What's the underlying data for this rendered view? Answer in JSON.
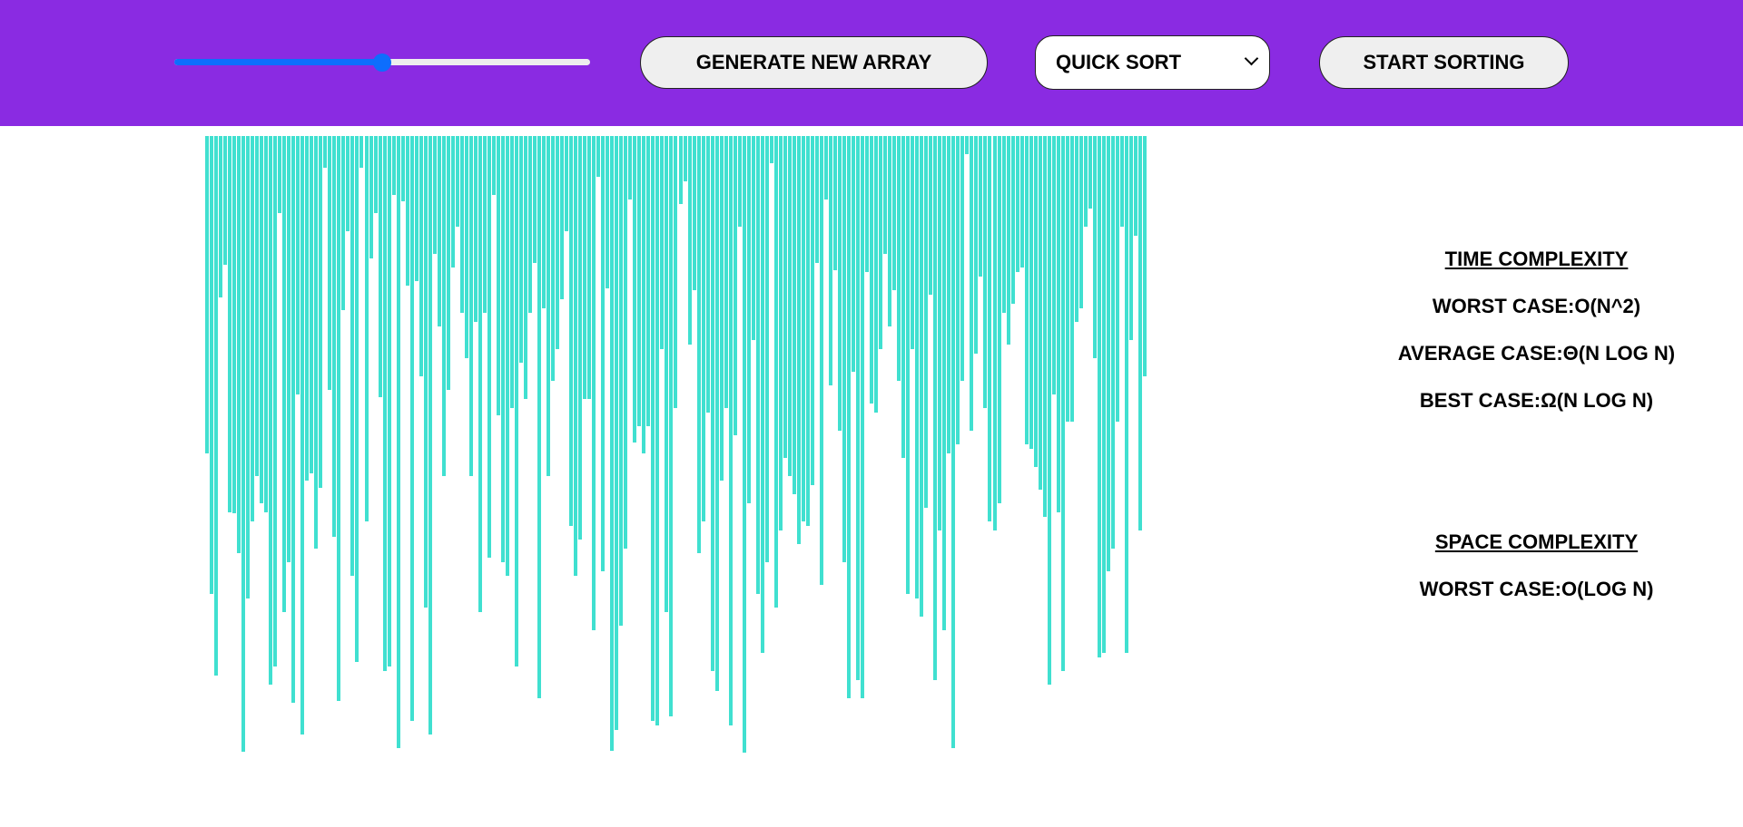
{
  "controls": {
    "array_size_slider": {
      "value": 0.5
    },
    "generate_button_label": "GENERATE NEW ARRAY",
    "algorithm_select": {
      "selected": "QUICK SORT",
      "icon": "chevron-down-icon"
    },
    "start_button_label": "START SORTING"
  },
  "colors": {
    "topbar": "#8a2be2",
    "bar": "#40e0d0",
    "slider_accent": "#0d6efd"
  },
  "complexity": {
    "time_heading": "TIME COMPLEXITY",
    "worst_case": "WORST CASE:O(N^2)",
    "average_case": "AVERAGE CASE:Θ(N LOG N)",
    "best_case": "BEST CASE:Ω(N LOG N)",
    "space_heading": "SPACE COMPLEXITY",
    "space_worst_case": "WORST CASE:O(LOG N)"
  },
  "chart_data": {
    "type": "bar",
    "values": [
      350,
      505,
      595,
      178,
      142,
      415,
      416,
      460,
      679,
      510,
      425,
      375,
      405,
      415,
      605,
      585,
      85,
      525,
      470,
      625,
      285,
      660,
      380,
      372,
      455,
      388,
      35,
      280,
      442,
      623,
      192,
      105,
      485,
      580,
      35,
      425,
      135,
      85,
      288,
      590,
      585,
      65,
      675,
      72,
      165,
      645,
      160,
      265,
      520,
      660,
      130,
      210,
      375,
      280,
      145,
      100,
      195,
      245,
      375,
      205,
      525,
      195,
      465,
      65,
      308,
      470,
      485,
      300,
      585,
      250,
      290,
      195,
      140,
      620,
      190,
      375,
      270,
      235,
      180,
      105,
      430,
      485,
      445,
      290,
      290,
      545,
      45,
      480,
      168,
      678,
      655,
      540,
      455,
      70,
      338,
      320,
      350,
      320,
      645,
      650,
      235,
      525,
      640,
      300,
      75,
      50,
      230,
      170,
      460,
      425,
      305,
      590,
      612,
      380,
      300,
      650,
      330,
      100,
      680,
      405,
      225,
      505,
      570,
      470,
      30,
      520,
      435,
      355,
      375,
      395,
      450,
      425,
      430,
      385,
      140,
      495,
      70,
      275,
      148,
      325,
      470,
      620,
      260,
      600,
      620,
      150,
      295,
      305,
      235,
      130,
      210,
      170,
      270,
      355,
      505,
      235,
      510,
      530,
      410,
      175,
      600,
      435,
      545,
      350,
      675,
      340,
      270,
      20,
      325,
      240,
      155,
      300,
      425,
      435,
      405,
      195,
      230,
      185,
      150,
      145,
      340,
      345,
      365,
      390,
      420,
      605,
      285,
      415,
      590,
      315,
      315,
      205,
      190,
      100,
      80,
      245,
      575,
      570,
      480,
      455,
      315,
      100,
      570,
      225,
      110,
      435,
      265
    ],
    "ylim": [
      0,
      700
    ],
    "grid": false
  }
}
